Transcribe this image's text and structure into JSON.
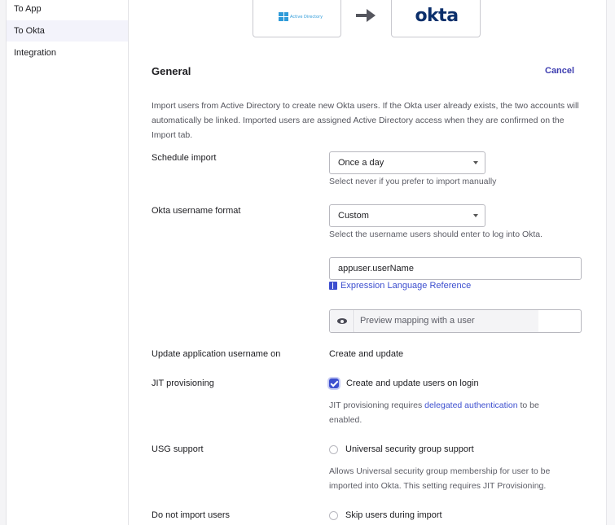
{
  "sidebar": {
    "items": [
      {
        "label": "To App"
      },
      {
        "label": "To Okta"
      },
      {
        "label": "Integration"
      }
    ]
  },
  "logos": {
    "source_text": "Active Directory",
    "target_text": "okta"
  },
  "header": {
    "title": "General",
    "cancel_label": "Cancel"
  },
  "description": "Import users from Active Directory to create new Okta users. If the Okta user already exists, the two accounts will automatically be linked. Imported users are assigned Active Directory access when they are confirmed on the Import tab.",
  "schedule_import": {
    "label": "Schedule import",
    "value": "Once a day",
    "hint": "Select never if you prefer to import manually"
  },
  "username_format": {
    "label": "Okta username format",
    "value": "Custom",
    "hint": "Select the username users should enter to log into Okta.",
    "expression": "appuser.userName",
    "link_label": "Expression Language Reference",
    "preview_placeholder": "Preview mapping with a user"
  },
  "update_username": {
    "label": "Update application username on",
    "value": "Create and update"
  },
  "jit": {
    "label": "JIT provisioning",
    "checkbox_label": "Create and update users on login",
    "checked": true,
    "hint_prefix": "JIT provisioning requires ",
    "hint_link": "delegated authentication",
    "hint_suffix": " to be enabled."
  },
  "usg": {
    "label": "USG support",
    "option_label": "Universal security group support",
    "hint": "Allows Universal security group membership for user to be imported into Okta. This setting requires JIT Provisioning."
  },
  "do_not_import": {
    "label": "Do not import users",
    "option_label": "Skip users during import"
  },
  "colors": {
    "accent": "#3d4fcf",
    "okta_navy": "#0b2f6b",
    "windows_blue": "#2f9bd9"
  }
}
